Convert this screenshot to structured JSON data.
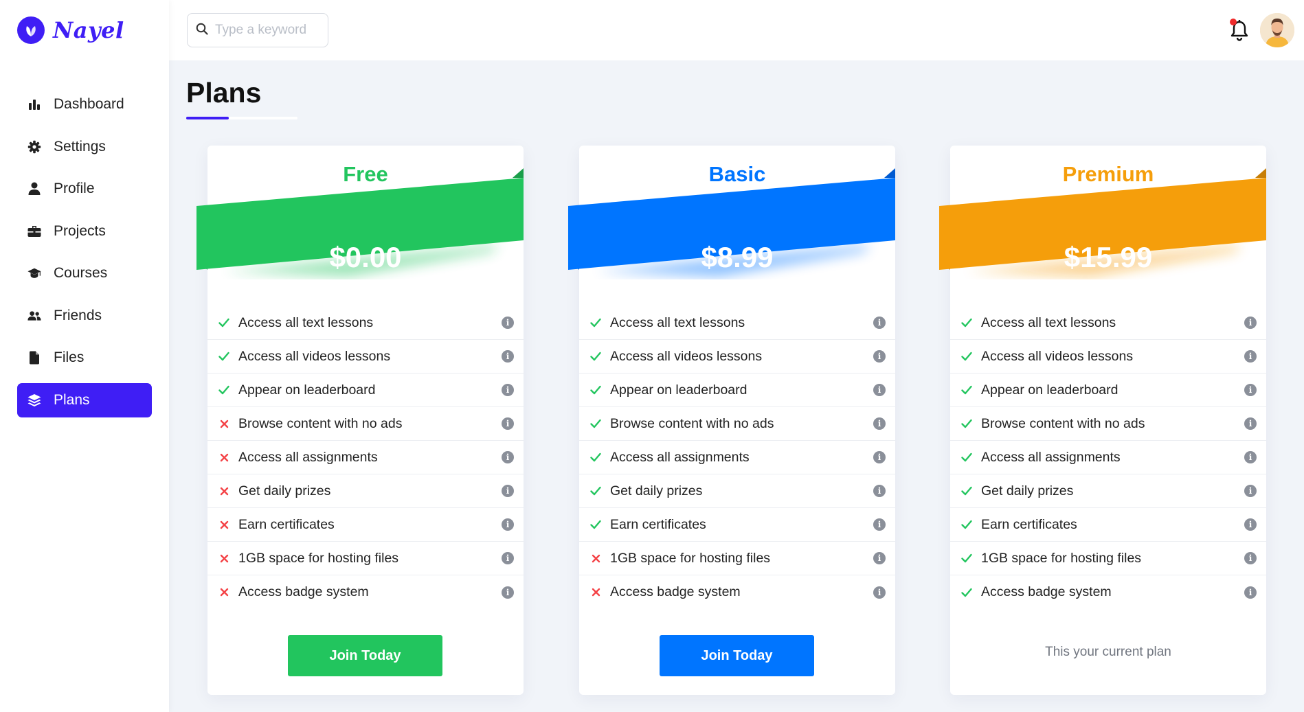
{
  "brand": {
    "name": "Nayel",
    "color": "#3f1ef5"
  },
  "search": {
    "placeholder": "Type a keyword"
  },
  "nav": [
    {
      "label": "Dashboard",
      "icon": "chart-bar-icon",
      "active": false
    },
    {
      "label": "Settings",
      "icon": "gear-icon",
      "active": false
    },
    {
      "label": "Profile",
      "icon": "user-icon",
      "active": false
    },
    {
      "label": "Projects",
      "icon": "briefcase-icon",
      "active": false
    },
    {
      "label": "Courses",
      "icon": "graduation-cap-icon",
      "active": false
    },
    {
      "label": "Friends",
      "icon": "users-icon",
      "active": false
    },
    {
      "label": "Files",
      "icon": "file-icon",
      "active": false
    },
    {
      "label": "Plans",
      "icon": "layers-icon",
      "active": true
    }
  ],
  "header": {
    "notifications_icon": "bell-icon",
    "has_unread": true
  },
  "page": {
    "title": "Plans"
  },
  "features": [
    "Access all text lessons",
    "Access all videos lessons",
    "Appear on leaderboard",
    "Browse content with no ads",
    "Access all assignments",
    "Get daily prizes",
    "Earn certificates",
    "1GB space for hosting files",
    "Access badge system"
  ],
  "plans": [
    {
      "name": "Free",
      "price": "$0.00",
      "color": "#22c55e",
      "dark": "#1a9e4a",
      "included": [
        true,
        true,
        true,
        false,
        false,
        false,
        false,
        false,
        false
      ],
      "action": "Join Today",
      "current_label": ""
    },
    {
      "name": "Basic",
      "price": "$8.99",
      "color": "#0075ff",
      "dark": "#005ad1",
      "included": [
        true,
        true,
        true,
        true,
        true,
        true,
        true,
        false,
        false
      ],
      "action": "Join Today",
      "current_label": ""
    },
    {
      "name": "Premium",
      "price": "$15.99",
      "color": "#f59e0b",
      "dark": "#c77e06",
      "included": [
        true,
        true,
        true,
        true,
        true,
        true,
        true,
        true,
        true
      ],
      "action": "",
      "current_label": "This your current plan"
    }
  ],
  "colors": {
    "check": "#22c55e",
    "cross": "#f44246",
    "background": "#f1f4f9"
  }
}
